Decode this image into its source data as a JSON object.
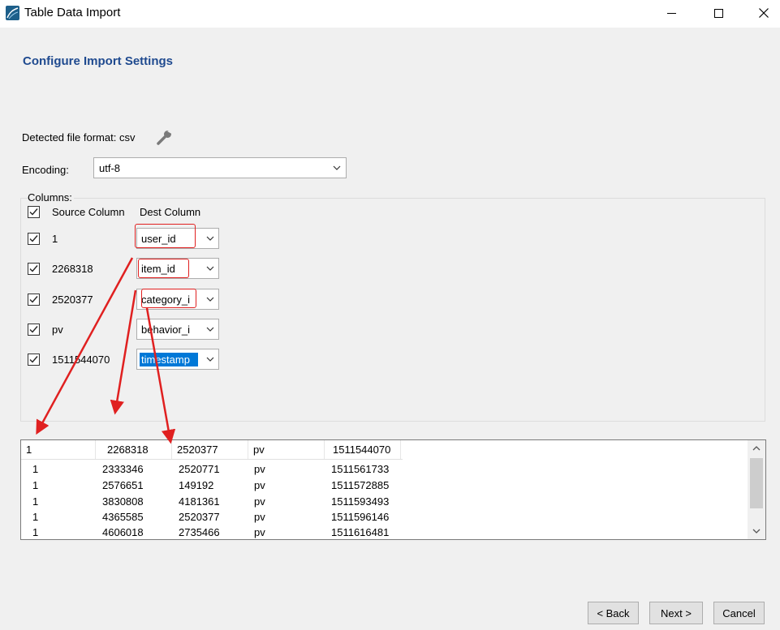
{
  "window": {
    "title": "Table Data Import"
  },
  "page": {
    "title": "Configure Import Settings",
    "format_label": "Detected file format: csv",
    "encoding_label": "Encoding:",
    "encoding_value": "utf-8",
    "columns_legend": "Columns:"
  },
  "columns": {
    "header_source": "Source Column",
    "header_dest": "Dest Column",
    "rows": [
      {
        "source": "1",
        "dest": "user_id",
        "checked": true
      },
      {
        "source": "2268318",
        "dest": "item_id",
        "checked": true
      },
      {
        "source": "2520377",
        "dest": "category_i",
        "checked": true
      },
      {
        "source": "pv",
        "dest": "behavior_i",
        "checked": true
      },
      {
        "source": "1511544070",
        "dest": "timestamp",
        "checked": true
      }
    ]
  },
  "preview": {
    "header": [
      "1",
      "2268318",
      "2520377",
      "pv",
      "1511544070"
    ],
    "rows": [
      [
        "1",
        "2333346",
        "2520771",
        "pv",
        "1511561733"
      ],
      [
        "1",
        "2576651",
        "149192",
        "pv",
        "1511572885"
      ],
      [
        "1",
        "3830808",
        "4181361",
        "pv",
        "1511593493"
      ],
      [
        "1",
        "4365585",
        "2520377",
        "pv",
        "1511596146"
      ],
      [
        "1",
        "4606018",
        "2735466",
        "pv",
        "1511616481"
      ]
    ]
  },
  "buttons": {
    "back": "< Back",
    "next": "Next >",
    "cancel": "Cancel"
  },
  "colors": {
    "title_accent": "#1f4a8f",
    "annotation_red": "#e02020",
    "selection_blue": "#0078d7"
  }
}
